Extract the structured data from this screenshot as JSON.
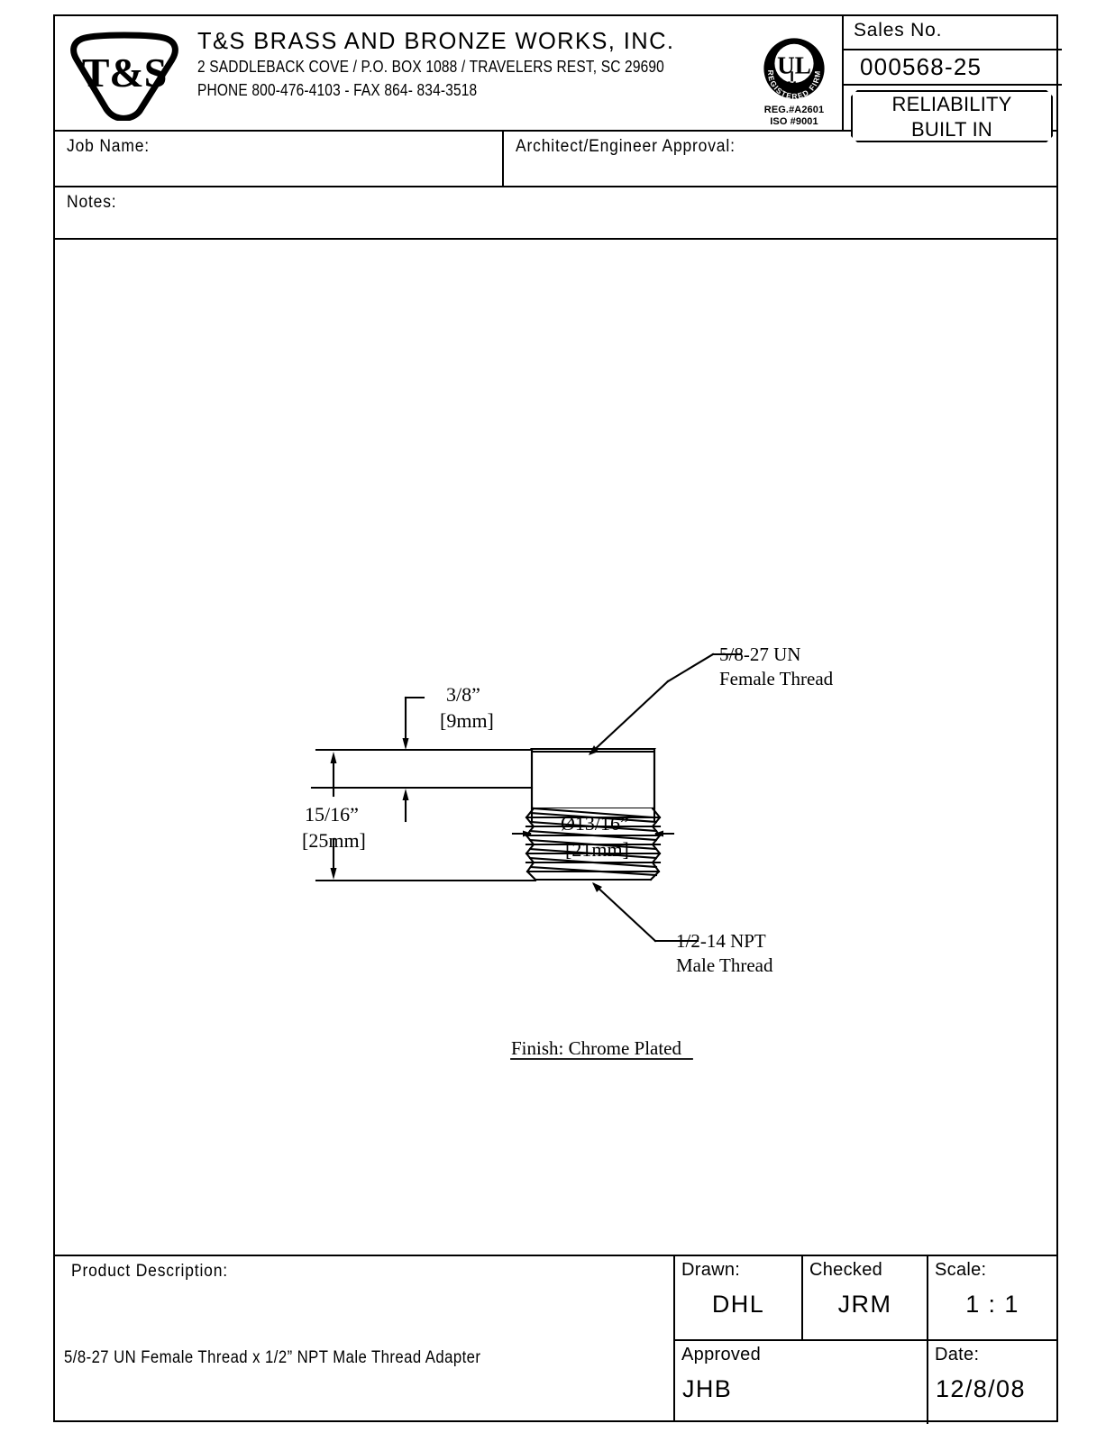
{
  "company": {
    "logo_text": "T&S",
    "name": "T&S BRASS AND BRONZE WORKS, INC.",
    "address": "2 SADDLEBACK COVE / P.O. BOX 1088 / TRAVELERS REST, SC 29690",
    "phone": "PHONE 800-476-4103 - FAX  864- 834-3518"
  },
  "ul": {
    "mark_text": "UL",
    "ring_text": "REGISTERED FIRM",
    "line1": "REG.#A2601",
    "line2": "ISO  #9001"
  },
  "sales": {
    "label": "Sales No.",
    "number": "000568-25",
    "plate_line1": "RELIABILITY",
    "plate_line2": "BUILT IN"
  },
  "form": {
    "job_name_label": "Job Name:",
    "job_name_value": "",
    "architect_label": "Architect/Engineer Approval:",
    "architect_value": "",
    "notes_label": "Notes:",
    "notes_value": ""
  },
  "drawing": {
    "dim_diameter_line1": "Ø13/16”",
    "dim_diameter_line2": "[21mm]",
    "dim_hex_line1": "3/8”",
    "dim_hex_line2": "[9mm]",
    "dim_length_line1": "15/16”",
    "dim_length_line2": "[25mm]",
    "callout_top_line1": "5/8-27 UN",
    "callout_top_line2": "Female Thread",
    "callout_bottom_line1": "1/2-14 NPT",
    "callout_bottom_line2": "Male Thread",
    "finish_note": "Finish: Chrome Plated"
  },
  "title_block": {
    "description_label": "Product Description:",
    "description_value": "5/8-27 UN Female Thread x 1/2” NPT Male Thread Adapter",
    "drawn_label": "Drawn:",
    "drawn_value": "DHL",
    "checked_label": "Checked",
    "checked_value": "JRM",
    "scale_label": "Scale:",
    "scale_value": "1 : 1",
    "approved_label": "Approved",
    "approved_value": "JHB",
    "date_label": "Date:",
    "date_value": "12/8/08"
  },
  "colors": {
    "line": "#000000",
    "paper": "#ffffff"
  }
}
